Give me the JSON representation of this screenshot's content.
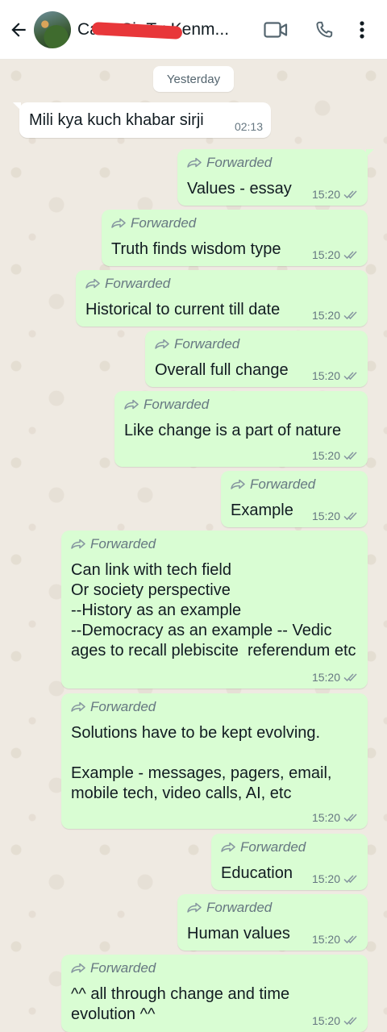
{
  "header": {
    "title": "Can't Sir Tg Kenm...",
    "back_icon": "arrow-left-icon",
    "video_icon": "video-call-icon",
    "call_icon": "phone-icon",
    "menu_icon": "more-vertical-icon"
  },
  "date_chip": "Yesterday",
  "forwarded_label": "Forwarded",
  "colors": {
    "outgoing_bubble": "#d9fdd3",
    "incoming_bubble": "#ffffff",
    "chat_background": "#efeae2"
  },
  "messages": [
    {
      "direction": "in",
      "forwarded": false,
      "text": "Mili kya kuch khabar sirji",
      "time": "02:13"
    },
    {
      "direction": "out",
      "forwarded": true,
      "text": "Values - essay",
      "time": "15:20"
    },
    {
      "direction": "out",
      "forwarded": true,
      "text": "Truth finds wisdom type",
      "time": "15:20"
    },
    {
      "direction": "out",
      "forwarded": true,
      "text": "Historical to current till date",
      "time": "15:20"
    },
    {
      "direction": "out",
      "forwarded": true,
      "text": "Overall full change",
      "time": "15:20"
    },
    {
      "direction": "out",
      "forwarded": true,
      "text": "Like change is a part of nature",
      "time": "15:20"
    },
    {
      "direction": "out",
      "forwarded": true,
      "text": "Example",
      "time": "15:20"
    },
    {
      "direction": "out",
      "forwarded": true,
      "text": "Can link with tech field\nOr society perspective\n--History as an example\n--Democracy as an example -- Vedic ages to recall plebiscite  referendum etc",
      "time": "15:20"
    },
    {
      "direction": "out",
      "forwarded": true,
      "text": "Solutions have to be kept evolving.\n\nExample - messages, pagers, email, mobile tech, video calls, AI, etc",
      "time": "15:20"
    },
    {
      "direction": "out",
      "forwarded": true,
      "text": "Education",
      "time": "15:20"
    },
    {
      "direction": "out",
      "forwarded": true,
      "text": "Human values",
      "time": "15:20"
    },
    {
      "direction": "out",
      "forwarded": true,
      "text": "^^ all through change and time evolution ^^",
      "time": "15:20"
    }
  ]
}
